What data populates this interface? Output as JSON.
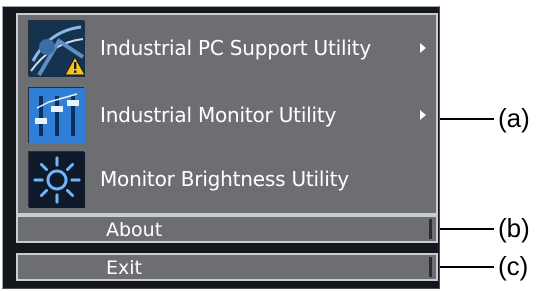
{
  "menu": {
    "apps": [
      {
        "label": "Industrial PC Support Utility",
        "icon": "pc-support-warning-icon",
        "has_submenu": true
      },
      {
        "label": "Industrial Monitor Utility",
        "icon": "monitor-sliders-icon",
        "has_submenu": true
      },
      {
        "label": "Monitor Brightness Utility",
        "icon": "brightness-sun-icon",
        "has_submenu": false
      }
    ],
    "about_label": "About",
    "exit_label": "Exit"
  },
  "callouts": {
    "a": "(a)",
    "b": "(b)",
    "c": "(c)"
  },
  "colors": {
    "menu_bg": "#14161b",
    "item_bg": "#6c6e72",
    "item_border": "#c9ccd1",
    "text": "#ffffff",
    "warning": "#f5c518",
    "icon_blue": "#2f7fd6"
  }
}
